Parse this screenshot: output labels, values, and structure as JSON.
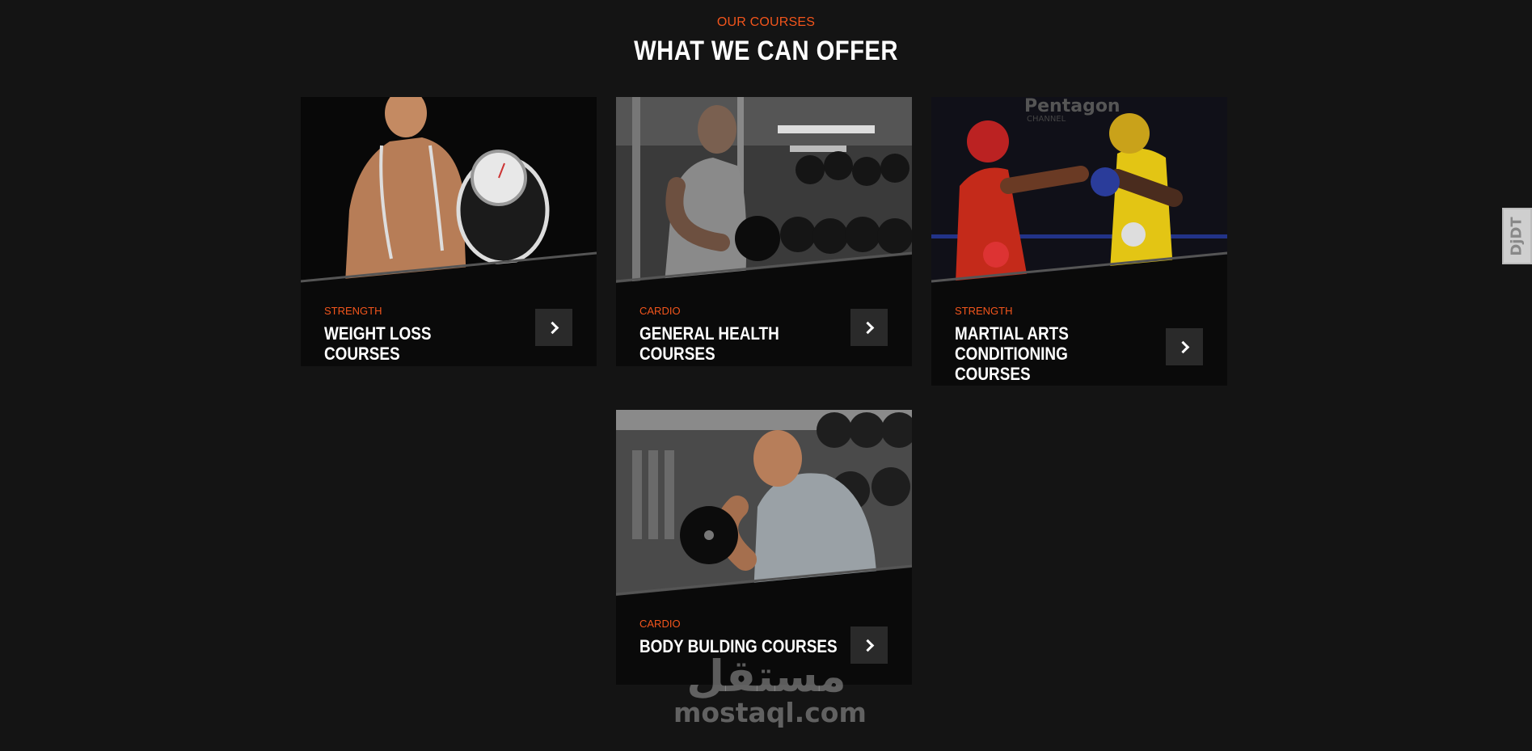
{
  "header": {
    "label": "OUR COURSES",
    "title": "WHAT WE CAN OFFER"
  },
  "cards": [
    {
      "category": "STRENGTH",
      "title": "WEIGHT LOSS COURSES",
      "image": "man-holding-scale-photo"
    },
    {
      "category": "CARDIO",
      "title": "GENERAL HEALTH COURSES",
      "image": "man-dumbbell-gym-photo"
    },
    {
      "category": "STRENGTH",
      "title": "MARTIAL ARTS CONDITIONING COURSES",
      "image": "boxing-match-photo"
    },
    {
      "category": "CARDIO",
      "title": "BODY BULDING COURSES",
      "image": "bodybuilder-curl-photo"
    }
  ],
  "side_tab": {
    "label": "DjDT"
  },
  "watermark": {
    "arabic": "مستقل",
    "latin": "mostaql.com"
  },
  "colors": {
    "accent": "#f2551c",
    "background": "#141414",
    "card": "#0a0a0a",
    "button": "#2a2a2a"
  }
}
